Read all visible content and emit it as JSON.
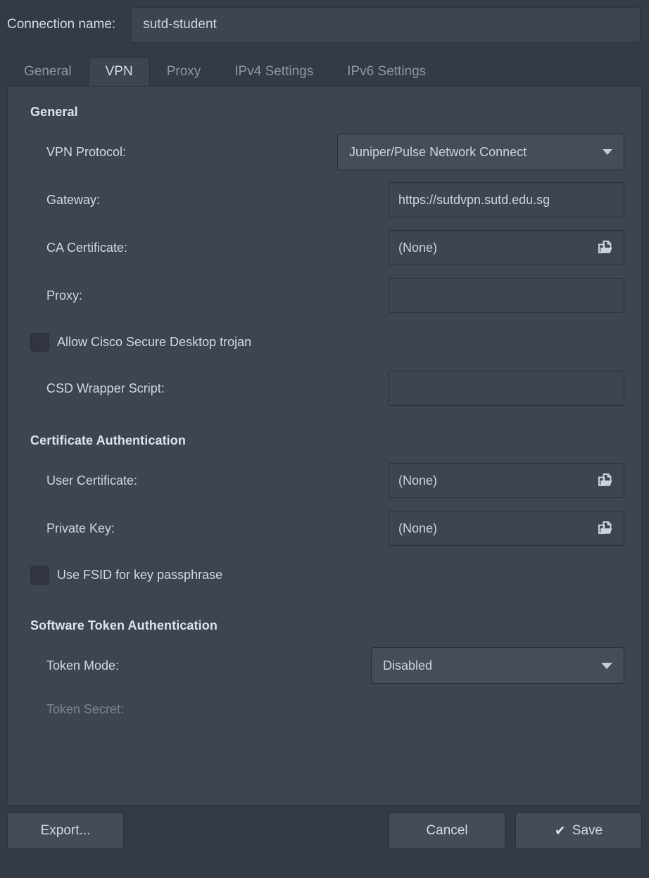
{
  "connection": {
    "label": "Connection name:",
    "value": "sutd-student",
    "placeholder": ""
  },
  "tabs": [
    {
      "label": "General",
      "active": false
    },
    {
      "label": "VPN",
      "active": true
    },
    {
      "label": "Proxy",
      "active": false
    },
    {
      "label": "IPv4 Settings",
      "active": false
    },
    {
      "label": "IPv6 Settings",
      "active": false
    }
  ],
  "sections": {
    "general": {
      "title": "General",
      "vpn_protocol": {
        "label": "VPN Protocol:",
        "value": "Juniper/Pulse Network Connect"
      },
      "gateway": {
        "label": "Gateway:",
        "value": "https://sutdvpn.sutd.edu.sg"
      },
      "ca_certificate": {
        "label": "CA Certificate:",
        "value": "(None)",
        "icon": "folder-open-icon"
      },
      "proxy": {
        "label": "Proxy:",
        "value": ""
      },
      "allow_csd": {
        "label": "Allow Cisco Secure Desktop trojan",
        "checked": false
      },
      "csd_wrapper": {
        "label": "CSD Wrapper Script:",
        "value": ""
      }
    },
    "certificate_auth": {
      "title": "Certificate Authentication",
      "user_certificate": {
        "label": "User Certificate:",
        "value": "(None)",
        "icon": "folder-open-icon"
      },
      "private_key": {
        "label": "Private Key:",
        "value": "(None)",
        "icon": "folder-open-icon"
      },
      "use_fsid": {
        "label": "Use FSID for key passphrase",
        "checked": false
      }
    },
    "software_token": {
      "title": "Software Token Authentication",
      "token_mode": {
        "label": "Token Mode:",
        "value": "Disabled"
      },
      "token_secret": {
        "label": "Token Secret:",
        "value": "",
        "disabled": true
      }
    }
  },
  "buttons": {
    "export": "Export...",
    "cancel": "Cancel",
    "save": "Save",
    "save_glyph": "✔"
  },
  "colors": {
    "window_background": "#353a47",
    "panel_background": "#3f4550",
    "border": "#2d313c",
    "text": "#d3d8e0",
    "text_muted": "#8e95a3",
    "control_background": "#464c58"
  }
}
